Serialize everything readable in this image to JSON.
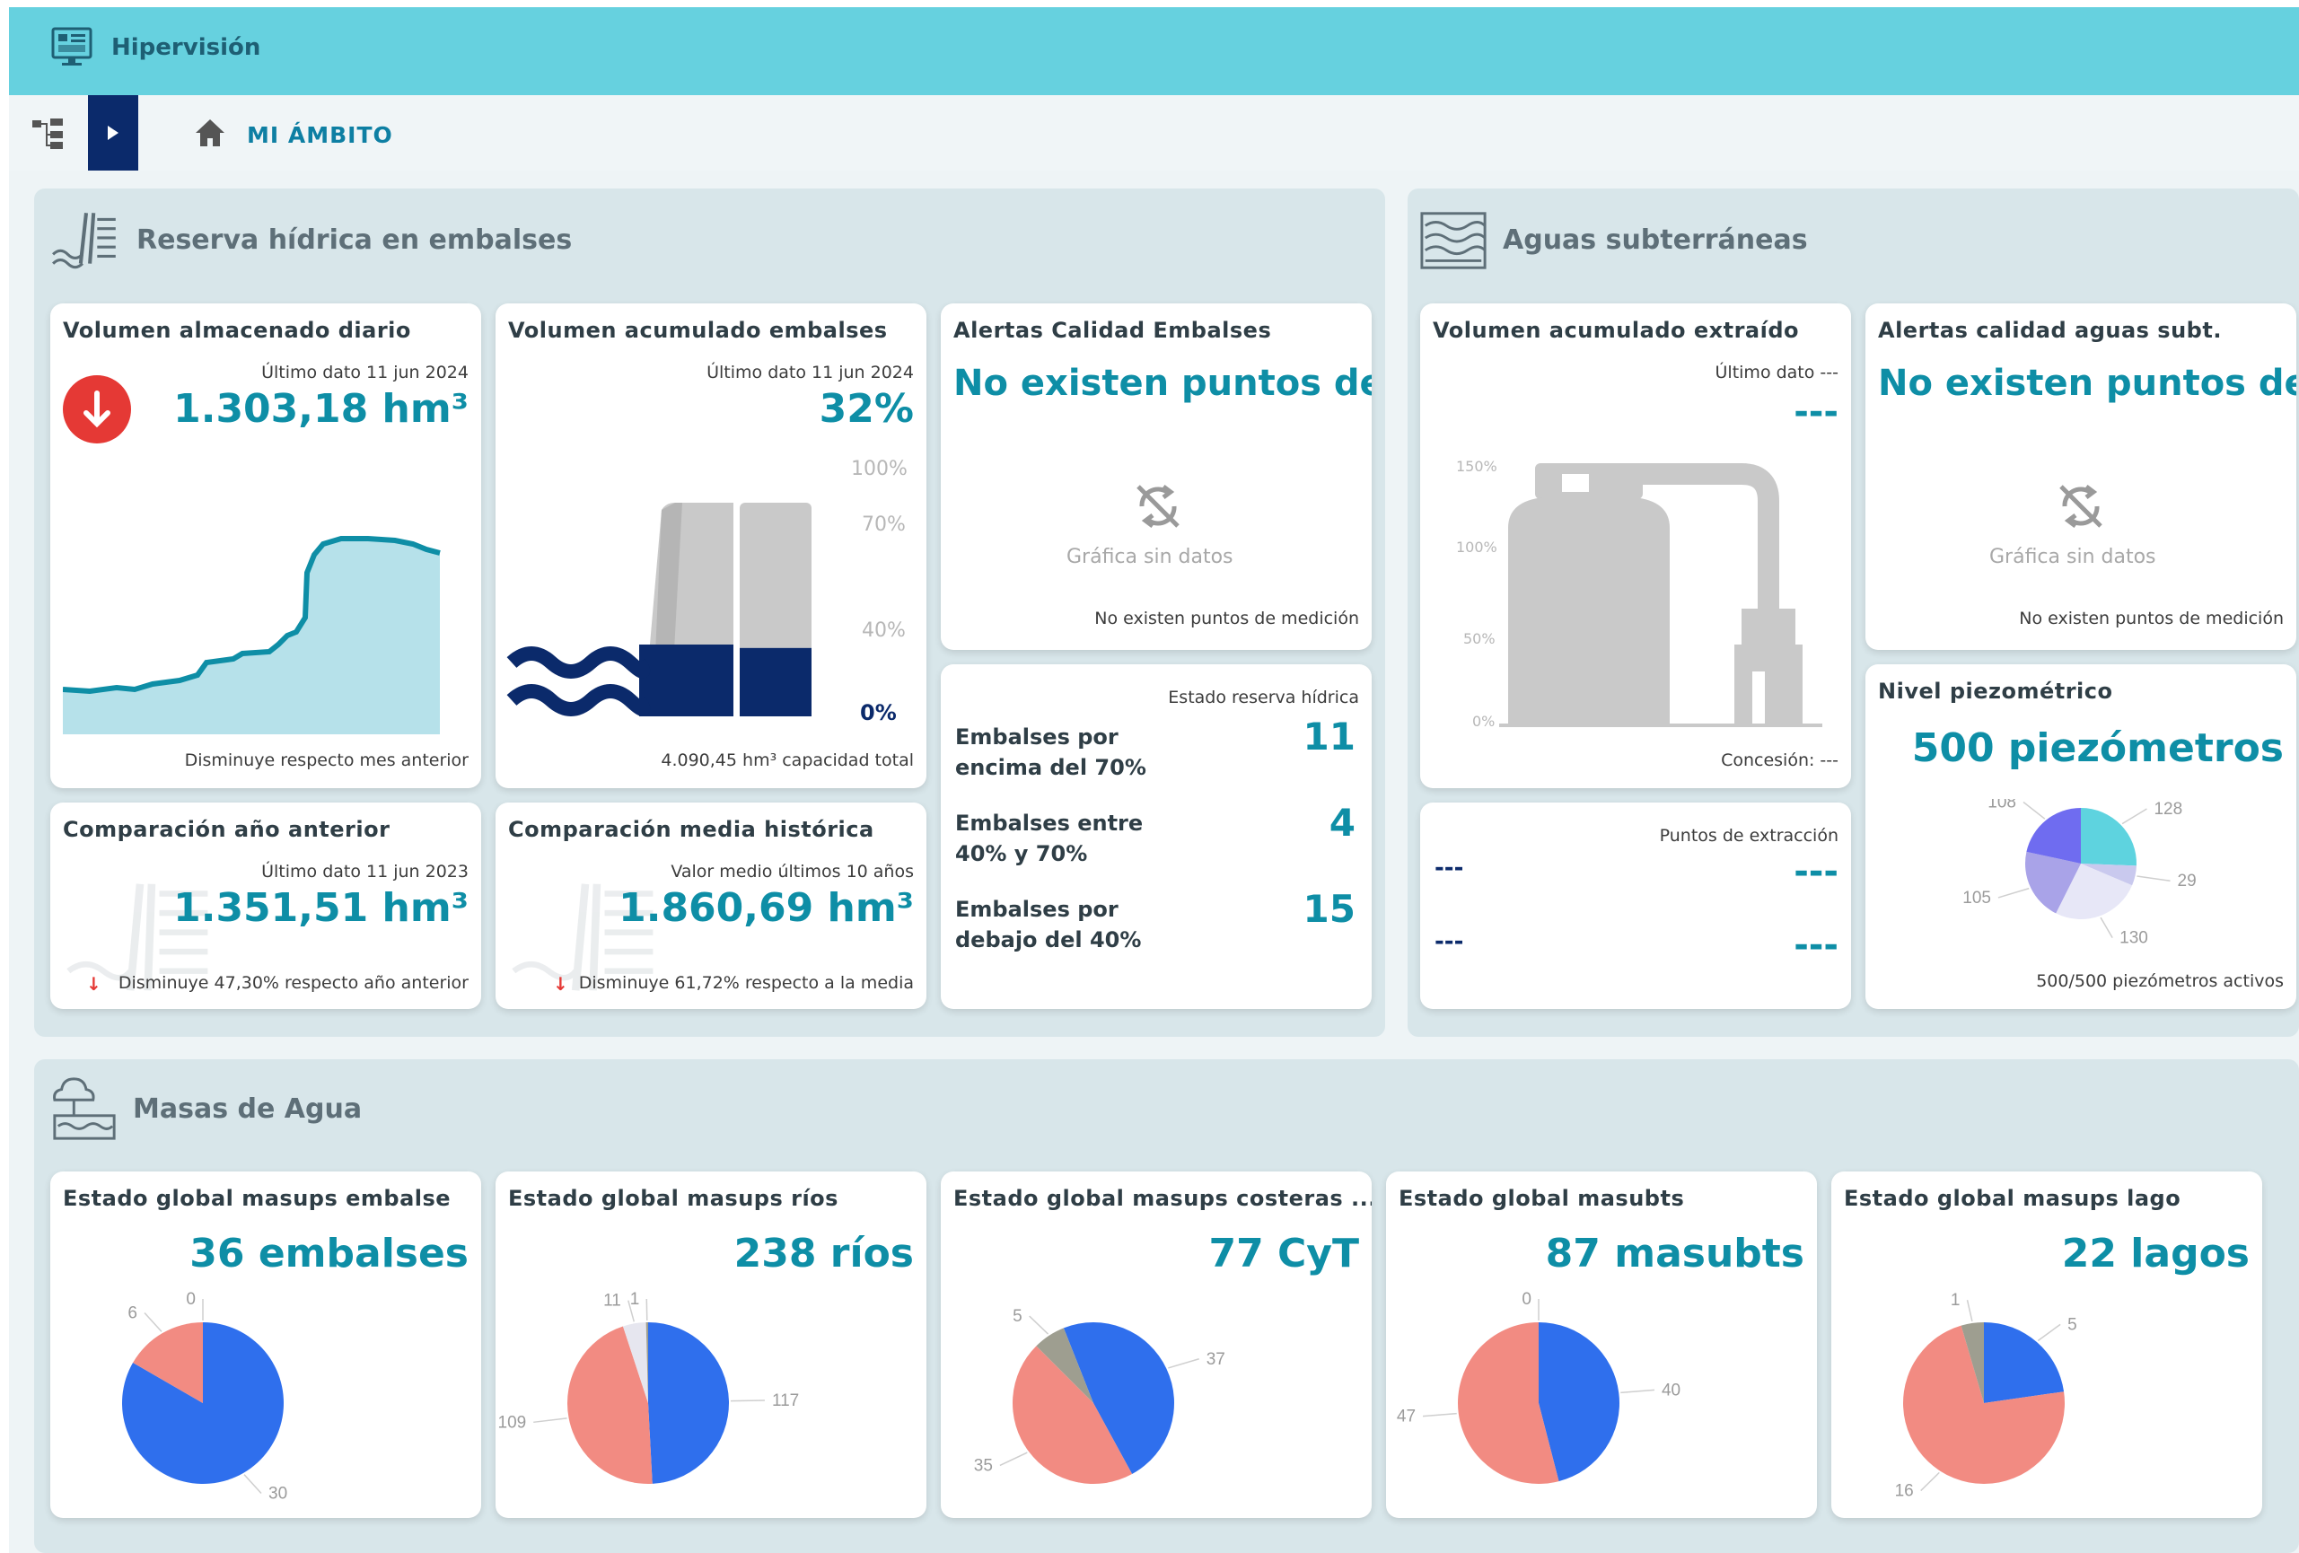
{
  "app": {
    "title": "Hipervisión"
  },
  "breadcrumb": {
    "label": "MI ÁMBITO"
  },
  "sections": {
    "reserva": "Reserva hídrica en embalses",
    "subterraneas": "Aguas subterráneas",
    "masas": "Masas de Agua"
  },
  "cards": {
    "vol_diario": {
      "title": "Volumen almacenado diario",
      "date": "Último dato 11 jun 2024",
      "value": "1.303,18 hm³",
      "footer": "Disminuye respecto mes anterior"
    },
    "vol_acumulado": {
      "title": "Volumen acumulado embalses",
      "date": "Último dato 11 jun 2024",
      "value": "32%",
      "ticks": [
        "100%",
        "70%",
        "40%",
        "0%"
      ],
      "footer": "4.090,45 hm³ capacidad total",
      "fill_fraction": 0.32
    },
    "alertas_embalses": {
      "title": "Alertas Calidad Embalses",
      "value": "No existen puntos de...",
      "nodata": "Gráfica sin datos",
      "footer": "No existen puntos de medición"
    },
    "estado_reserva": {
      "header": "Estado reserva hídrica",
      "rows": [
        {
          "label": "Embalses por encima del 70%",
          "value": "11"
        },
        {
          "label": "Embalses entre 40% y 70%",
          "value": "4"
        },
        {
          "label": "Embalses por debajo del 40%",
          "value": "15"
        }
      ]
    },
    "comparacion_anterior": {
      "title": "Comparación año anterior",
      "date": "Último dato 11 jun 2023",
      "value": "1.351,51 hm³",
      "footer": "Disminuye 47,30% respecto año anterior"
    },
    "comparacion_media": {
      "title": "Comparación media histórica",
      "date": "Valor medio últimos 10 años",
      "value": "1.860,69 hm³",
      "footer": "Disminuye 61,72% respecto a la media"
    },
    "vol_extraido": {
      "title": "Volumen acumulado extraído",
      "date": "Último dato ---",
      "value": "---",
      "ticks": [
        "150%",
        "100%",
        "50%",
        "0%"
      ],
      "footer": "Concesión: ---"
    },
    "alertas_subt": {
      "title": "Alertas calidad aguas subt.",
      "value": "No existen puntos de...",
      "nodata": "Gráfica sin datos",
      "footer": "No existen puntos de medición"
    },
    "puntos_extraccion": {
      "header": "Puntos de extracción",
      "rows": [
        {
          "left": "---",
          "right": "---"
        },
        {
          "left": "---",
          "right": "---"
        }
      ]
    },
    "nivel_piezo": {
      "title": "Nivel piezométrico",
      "value": "500 piezómetros",
      "footer": "500/500 piezómetros activos"
    },
    "masas": [
      {
        "title": "Estado global masups embalse",
        "value": "36 embalses"
      },
      {
        "title": "Estado global masups ríos",
        "value": "238 ríos"
      },
      {
        "title": "Estado global masups costeras ...",
        "value": "77 CyT"
      },
      {
        "title": "Estado global masubts",
        "value": "87 masubts"
      },
      {
        "title": "Estado global masups lago",
        "value": "22 lagos"
      }
    ]
  },
  "colors": {
    "blue": "#2f6fed",
    "salmon": "#f28b82",
    "gray": "#9e9e90",
    "light": "#e6e6ef",
    "accent": "#0e8ea6",
    "cyan": "#5ed3df",
    "violet": "#6f6cf0",
    "lavender": "#a9a3e8",
    "pale": "#e7e7f7"
  },
  "chart_data": [
    {
      "type": "pie",
      "title": "Nivel piezométrico",
      "categories": [
        "128",
        "29",
        "130",
        "105",
        "108"
      ],
      "values": [
        128,
        29,
        130,
        105,
        108
      ],
      "colors": [
        "#5ed3df",
        "#c9c9ee",
        "#e7e7f7",
        "#a9a3e8",
        "#6f6cf0"
      ]
    },
    {
      "type": "pie",
      "title": "Estado global masups embalse",
      "categories": [
        "30",
        "6",
        "0"
      ],
      "values": [
        30,
        6,
        0
      ],
      "colors": [
        "#2f6fed",
        "#f28b82",
        "#9e9e90"
      ]
    },
    {
      "type": "pie",
      "title": "Estado global masups ríos",
      "categories": [
        "117",
        "109",
        "11",
        "1"
      ],
      "values": [
        117,
        109,
        11,
        1
      ],
      "colors": [
        "#2f6fed",
        "#f28b82",
        "#e6e6ef",
        "#9e9e90"
      ]
    },
    {
      "type": "pie",
      "title": "Estado global masups costeras ...",
      "categories": [
        "37",
        "35",
        "5"
      ],
      "values": [
        37,
        35,
        5
      ],
      "colors": [
        "#2f6fed",
        "#f28b82",
        "#9e9e90"
      ]
    },
    {
      "type": "pie",
      "title": "Estado global masubts",
      "categories": [
        "40",
        "47",
        "0"
      ],
      "values": [
        40,
        47,
        0
      ],
      "colors": [
        "#2f6fed",
        "#f28b82",
        "#9e9e90"
      ]
    },
    {
      "type": "pie",
      "title": "Estado global masups lago",
      "categories": [
        "5",
        "16",
        "1"
      ],
      "values": [
        5,
        16,
        1
      ],
      "colors": [
        "#2f6fed",
        "#f28b82",
        "#9e9e90"
      ]
    }
  ]
}
